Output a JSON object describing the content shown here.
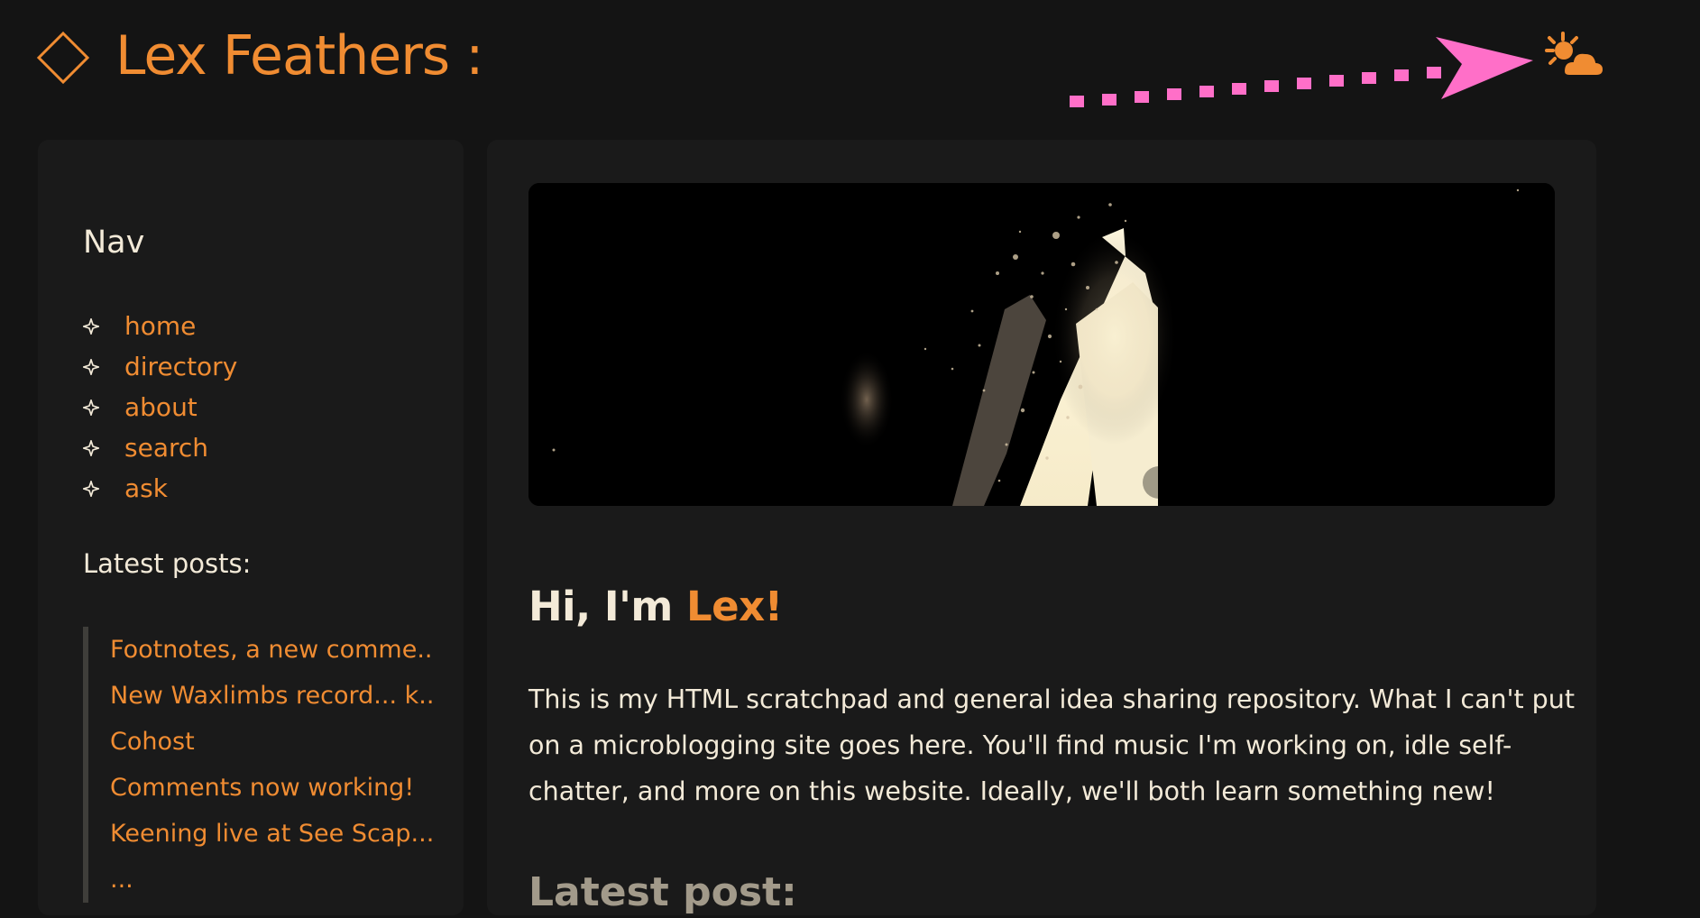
{
  "header": {
    "title": "Lex Feathers :",
    "logo_icon": "diamond-outline-icon",
    "theme_toggle_icon": "sun-behind-cloud-icon",
    "annotation_icon": "pink-dotted-arrow-icon"
  },
  "sidebar": {
    "nav_title": "Nav",
    "nav_items": [
      {
        "label": "home"
      },
      {
        "label": "directory"
      },
      {
        "label": "about"
      },
      {
        "label": "search"
      },
      {
        "label": "ask"
      }
    ],
    "latest_posts_title": "Latest posts:",
    "latest_posts": [
      {
        "label": "Footnotes, a new comme..."
      },
      {
        "label": "New Waxlimbs record... k..."
      },
      {
        "label": "Cohost"
      },
      {
        "label": "Comments now working!"
      },
      {
        "label": "Keening live at See Scap..."
      },
      {
        "label": "..."
      }
    ]
  },
  "main": {
    "greeting_prefix": "Hi, I'm ",
    "greeting_name": "Lex!",
    "intro": "This is my HTML scratchpad and general idea sharing repository. What I can't put on a microblogging site goes here. You'll find music I'm working on, idle self-chatter, and more on this website. Ideally, we'll both learn something new!",
    "latest_post_title": "Latest post:"
  },
  "colors": {
    "background": "#141414",
    "panel": "#1a1a1a",
    "accent": "#f08c32",
    "text": "#f3ead8",
    "muted": "#a29a8a",
    "annotation": "#ff6fc8"
  }
}
